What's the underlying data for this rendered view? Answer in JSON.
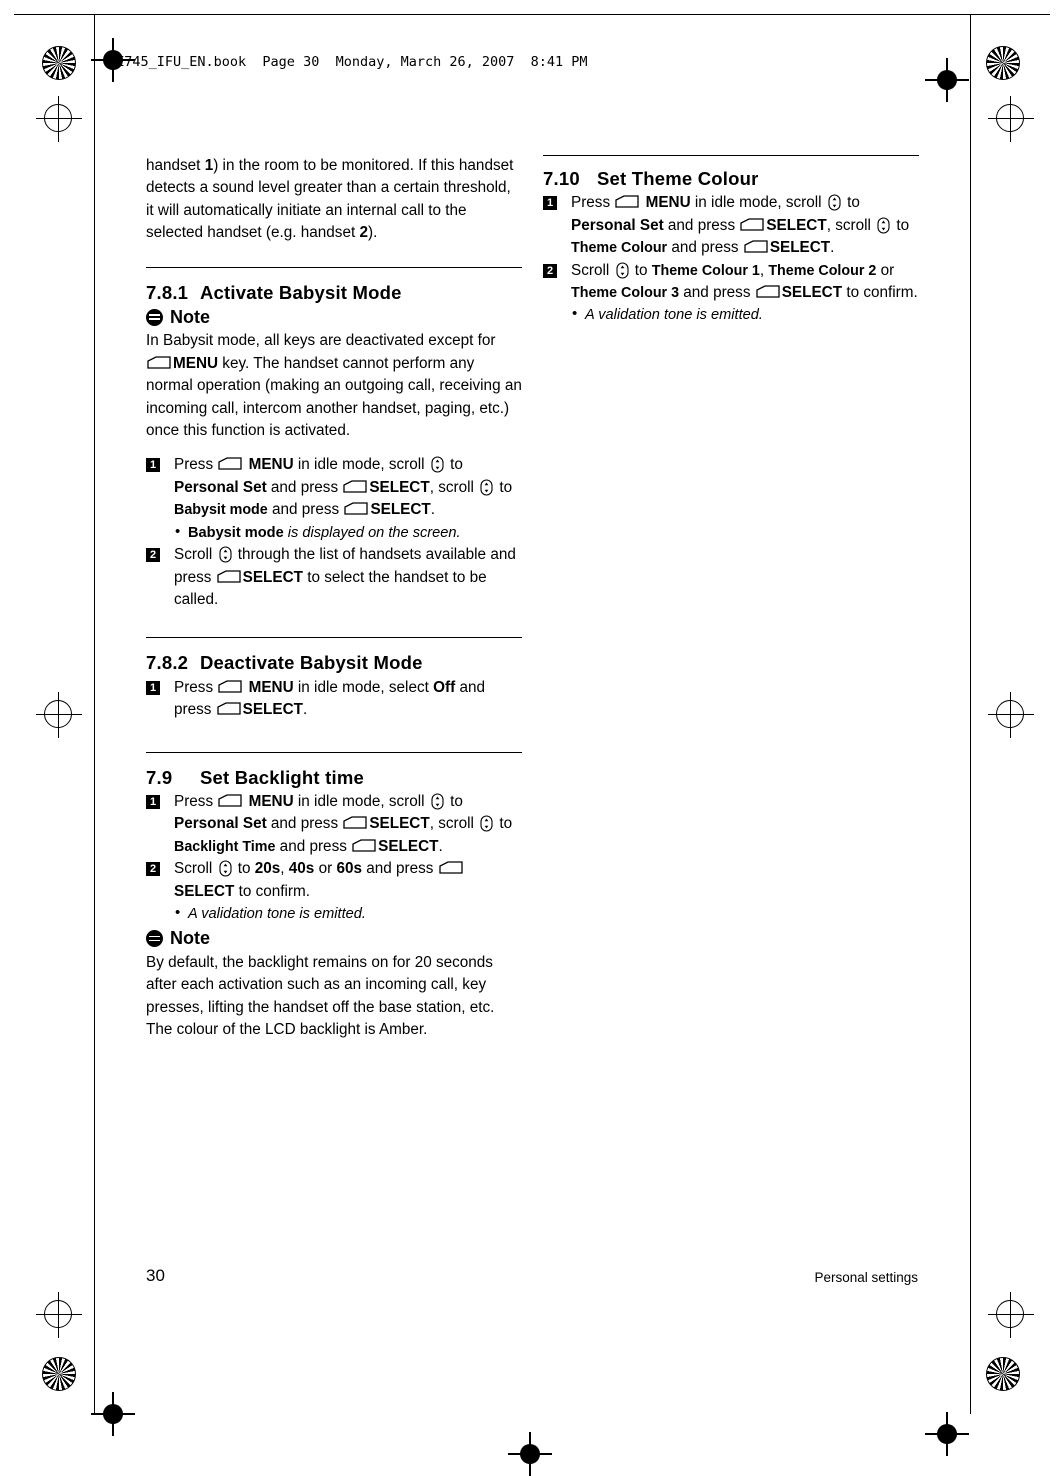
{
  "header": {
    "slug": "SE745_IFU_EN.book  Page 30  Monday, March 26, 2007  8:41 PM"
  },
  "left_column": {
    "intro_paragraph": "handset 1) in the room to be monitored. If this handset detects a sound level greater than a certain threshold, it will automatically initiate an internal call to the selected handset (e.g. handset 2).",
    "sections": [
      {
        "number": "7.8.1",
        "title": "Activate Babysit Mode",
        "note_label": "Note",
        "note_text_parts": [
          "In Babysit mode, all keys are deactivated except for ",
          "MENU",
          " key. The handset cannot perform any normal operation (making an outgoing call, receiving an incoming call, intercom another handset, paging, etc.) once this function is activated."
        ],
        "steps": [
          {
            "num": "1",
            "parts": [
              {
                "t": "Press ",
                "s": "plain"
              },
              {
                "t": "menu-key-icon",
                "s": "key-menu"
              },
              {
                "t": "MENU",
                "s": "bold"
              },
              {
                "t": " in idle mode, scroll ",
                "s": "plain"
              },
              {
                "t": "scroll-key-icon",
                "s": "key-scroll"
              },
              {
                "t": " to ",
                "s": "plain"
              },
              {
                "t": "Personal Set",
                "s": "bold"
              },
              {
                "t": " and press ",
                "s": "plain"
              },
              {
                "t": "menu-key-icon",
                "s": "key-menu"
              },
              {
                "t": "SELECT",
                "s": "bold"
              },
              {
                "t": ", scroll ",
                "s": "plain"
              },
              {
                "t": "scroll-key-icon",
                "s": "key-scroll"
              },
              {
                "t": " to ",
                "s": "plain"
              },
              {
                "t": "Babysit mode",
                "s": "bold-small"
              },
              {
                "t": " and press ",
                "s": "plain"
              },
              {
                "t": "menu-key-icon",
                "s": "key-menu"
              },
              {
                "t": "SELECT",
                "s": "bold"
              },
              {
                "t": ".",
                "s": "plain"
              }
            ],
            "bullets": [
              {
                "bold": "Babysit mode",
                "italic": " is displayed on the screen."
              }
            ]
          },
          {
            "num": "2",
            "parts": [
              {
                "t": "Scroll ",
                "s": "plain"
              },
              {
                "t": "scroll-key-icon",
                "s": "key-scroll"
              },
              {
                "t": " through the list of handsets available and press ",
                "s": "plain"
              },
              {
                "t": "menu-key-icon",
                "s": "key-menu"
              },
              {
                "t": "SELECT",
                "s": "bold"
              },
              {
                "t": " to select the handset to be called.",
                "s": "plain"
              }
            ],
            "bullets": []
          }
        ]
      },
      {
        "number": "7.8.2",
        "title": "Deactivate Babysit Mode",
        "steps": [
          {
            "num": "1",
            "parts": [
              {
                "t": "Press ",
                "s": "plain"
              },
              {
                "t": "menu-key-icon",
                "s": "key-menu"
              },
              {
                "t": "MENU",
                "s": "bold"
              },
              {
                "t": " in idle mode, select ",
                "s": "plain"
              },
              {
                "t": "Off",
                "s": "bold"
              },
              {
                "t": " and press ",
                "s": "plain"
              },
              {
                "t": "menu-key-icon",
                "s": "key-menu"
              },
              {
                "t": "SELECT",
                "s": "bold"
              },
              {
                "t": ".",
                "s": "plain"
              }
            ],
            "bullets": []
          }
        ]
      },
      {
        "number": "7.9",
        "title": "Set Backlight time",
        "steps": [
          {
            "num": "1",
            "parts": [
              {
                "t": "Press ",
                "s": "plain"
              },
              {
                "t": "menu-key-icon",
                "s": "key-menu"
              },
              {
                "t": "MENU",
                "s": "bold"
              },
              {
                "t": " in idle mode, scroll ",
                "s": "plain"
              },
              {
                "t": "scroll-key-icon",
                "s": "key-scroll"
              },
              {
                "t": " to ",
                "s": "plain"
              },
              {
                "t": "Personal Set",
                "s": "bold"
              },
              {
                "t": " and press ",
                "s": "plain"
              },
              {
                "t": "menu-key-icon",
                "s": "key-menu"
              },
              {
                "t": "SELECT",
                "s": "bold"
              },
              {
                "t": ", scroll ",
                "s": "plain"
              },
              {
                "t": "scroll-key-icon",
                "s": "key-scroll"
              },
              {
                "t": " to ",
                "s": "plain"
              },
              {
                "t": "Backlight Time",
                "s": "bold-small"
              },
              {
                "t": " and press ",
                "s": "plain"
              },
              {
                "t": "menu-key-icon",
                "s": "key-menu"
              },
              {
                "t": "SELECT",
                "s": "bold"
              },
              {
                "t": ".",
                "s": "plain"
              }
            ],
            "bullets": []
          },
          {
            "num": "2",
            "parts": [
              {
                "t": "Scroll ",
                "s": "plain"
              },
              {
                "t": "scroll-key-icon",
                "s": "key-scroll"
              },
              {
                "t": " to ",
                "s": "plain"
              },
              {
                "t": "20s",
                "s": "bold"
              },
              {
                "t": ", ",
                "s": "plain"
              },
              {
                "t": "40s",
                "s": "bold"
              },
              {
                "t": " or ",
                "s": "plain"
              },
              {
                "t": "60s",
                "s": "bold"
              },
              {
                "t": " and press ",
                "s": "plain"
              },
              {
                "t": "menu-key-icon",
                "s": "key-menu"
              },
              {
                "t": "SELECT",
                "s": "bold"
              },
              {
                "t": " to confirm.",
                "s": "plain"
              }
            ],
            "bullets": [
              {
                "bold": "",
                "italic": "A validation tone is emitted."
              }
            ]
          }
        ],
        "note_label": "Note",
        "note_body": "By default, the backlight remains on for 20 seconds after each activation such as an incoming call, key presses, lifting the handset off the base station, etc. The colour of the LCD backlight is Amber."
      }
    ]
  },
  "right_column": {
    "section": {
      "number": "7.10",
      "title": "Set Theme Colour",
      "steps": [
        {
          "num": "1",
          "parts": [
            {
              "t": "Press ",
              "s": "plain"
            },
            {
              "t": "menu-key-icon",
              "s": "key-menu"
            },
            {
              "t": "MENU",
              "s": "bold"
            },
            {
              "t": " in idle mode, scroll ",
              "s": "plain"
            },
            {
              "t": "scroll-key-icon",
              "s": "key-scroll"
            },
            {
              "t": " to ",
              "s": "plain"
            },
            {
              "t": "Personal Set",
              "s": "bold"
            },
            {
              "t": " and press ",
              "s": "plain"
            },
            {
              "t": "menu-key-icon",
              "s": "key-menu"
            },
            {
              "t": "SELECT",
              "s": "bold"
            },
            {
              "t": ", scroll ",
              "s": "plain"
            },
            {
              "t": "scroll-key-icon",
              "s": "key-scroll"
            },
            {
              "t": " to ",
              "s": "plain"
            },
            {
              "t": "Theme Colour",
              "s": "bold-small"
            },
            {
              "t": " and press ",
              "s": "plain"
            },
            {
              "t": "menu-key-icon",
              "s": "key-menu"
            },
            {
              "t": "SELECT",
              "s": "bold"
            },
            {
              "t": ".",
              "s": "plain"
            }
          ],
          "bullets": []
        },
        {
          "num": "2",
          "parts": [
            {
              "t": "Scroll ",
              "s": "plain"
            },
            {
              "t": "scroll-key-icon",
              "s": "key-scroll"
            },
            {
              "t": " to ",
              "s": "plain"
            },
            {
              "t": "Theme Colour 1",
              "s": "bold-small"
            },
            {
              "t": ", ",
              "s": "plain"
            },
            {
              "t": "Theme Colour 2",
              "s": "bold-small"
            },
            {
              "t": " or ",
              "s": "plain"
            },
            {
              "t": "Theme Colour 3",
              "s": "bold-small"
            },
            {
              "t": " and press ",
              "s": "plain"
            },
            {
              "t": "menu-key-icon",
              "s": "key-menu"
            },
            {
              "t": "SELECT",
              "s": "bold"
            },
            {
              "t": " to confirm.",
              "s": "plain"
            }
          ],
          "bullets": [
            {
              "bold": "",
              "italic": "A validation tone is emitted."
            }
          ]
        }
      ]
    }
  },
  "footer": {
    "page_number": "30",
    "chapter": "Personal settings"
  }
}
